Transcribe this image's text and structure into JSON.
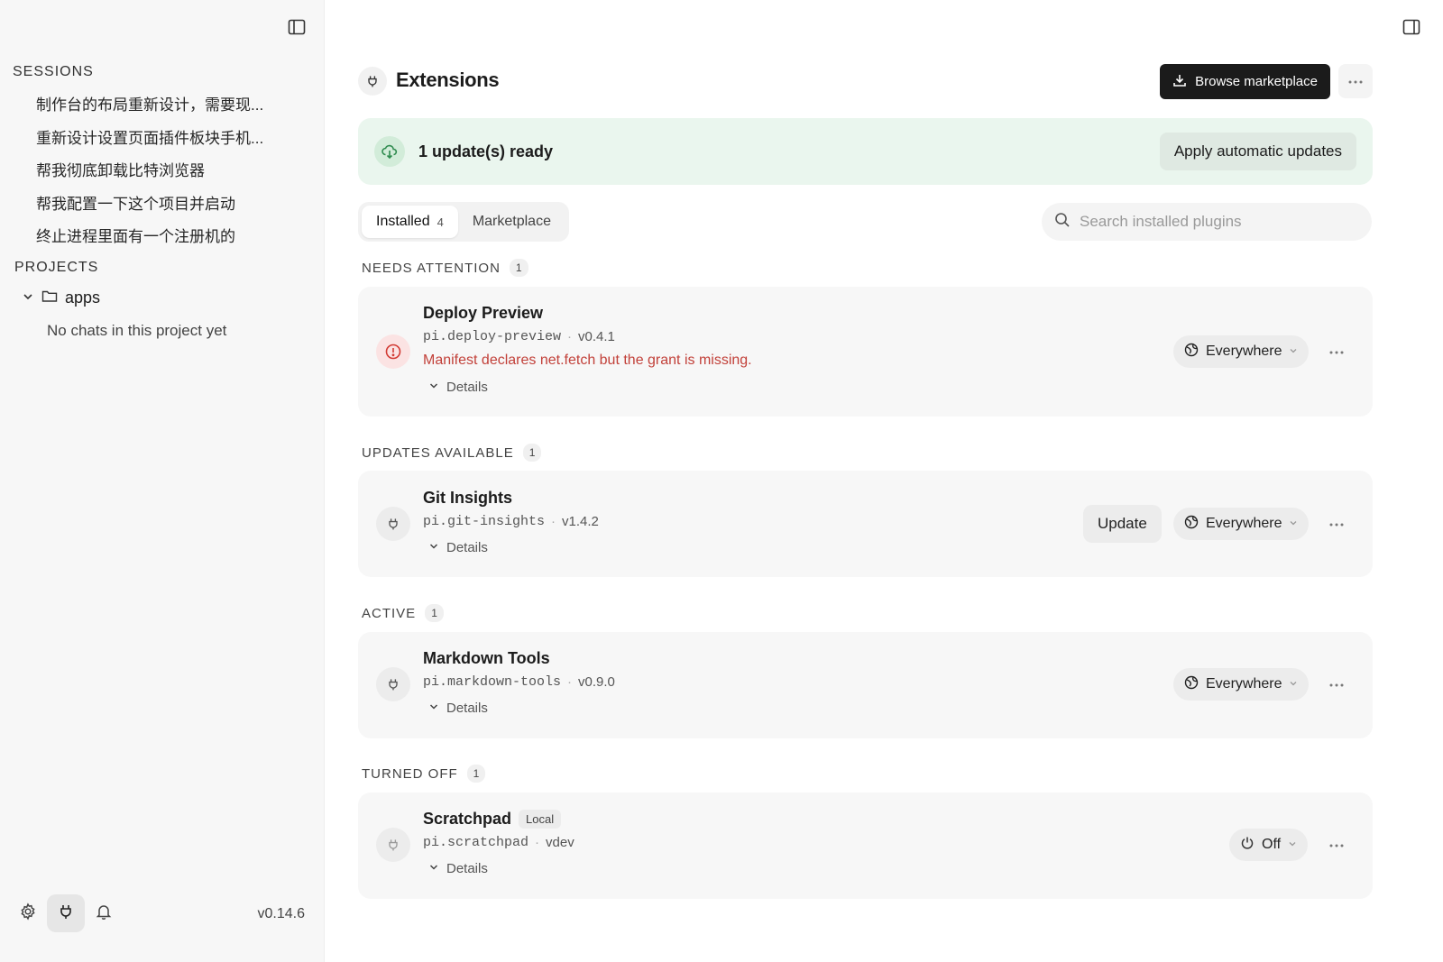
{
  "sidebar": {
    "sessions_heading": "SESSIONS",
    "sessions": [
      "制作台的布局重新设计，需要现...",
      "重新设计设置页面插件板块手机...",
      "帮我彻底卸载比特浏览器",
      "帮我配置一下这个项目并启动",
      "终止进程里面有一个注册机的"
    ],
    "projects_heading": "PROJECTS",
    "project_name": "apps",
    "project_empty": "No chats in this project yet",
    "version": "v0.14.6"
  },
  "header": {
    "title": "Extensions",
    "browse_label": "Browse marketplace"
  },
  "banner": {
    "text": "1 update(s) ready",
    "apply_label": "Apply automatic updates"
  },
  "tabs": {
    "installed_label": "Installed",
    "installed_count": "4",
    "marketplace_label": "Marketplace"
  },
  "search": {
    "placeholder": "Search installed plugins"
  },
  "groups": {
    "needs_attention": {
      "label": "NEEDS ATTENTION",
      "count": "1"
    },
    "updates_available": {
      "label": "UPDATES AVAILABLE",
      "count": "1"
    },
    "active": {
      "label": "ACTIVE",
      "count": "1"
    },
    "turned_off": {
      "label": "TURNED OFF",
      "count": "1"
    }
  },
  "plugins": {
    "deploy_preview": {
      "name": "Deploy Preview",
      "id": "pi.deploy-preview",
      "version": "v0.4.1",
      "error": "Manifest declares net.fetch but the grant is missing.",
      "details": "Details",
      "scope": "Everywhere"
    },
    "git_insights": {
      "name": "Git Insights",
      "id": "pi.git-insights",
      "version": "v1.4.2",
      "details": "Details",
      "update_label": "Update",
      "scope": "Everywhere"
    },
    "markdown_tools": {
      "name": "Markdown Tools",
      "id": "pi.markdown-tools",
      "version": "v0.9.0",
      "details": "Details",
      "scope": "Everywhere"
    },
    "scratchpad": {
      "name": "Scratchpad",
      "tag": "Local",
      "id": "pi.scratchpad",
      "version": "vdev",
      "details": "Details",
      "scope": "Off"
    }
  },
  "colors": {
    "accent_dark": "#1b1b1b",
    "banner_bg": "#eaf6ee",
    "error_red": "#c2413a"
  }
}
